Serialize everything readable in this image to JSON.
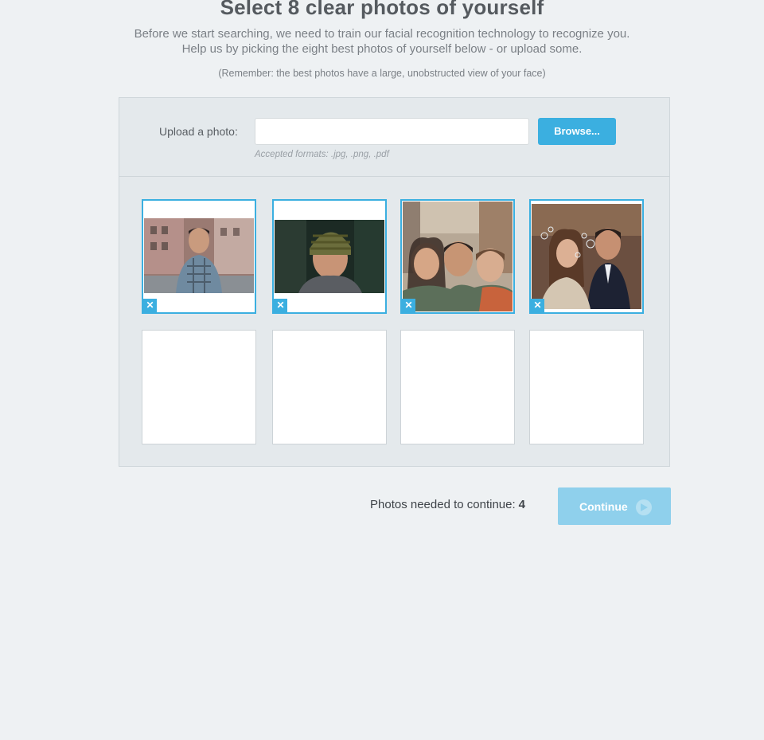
{
  "header": {
    "title": "Select 8 clear photos of yourself",
    "intro_line1": "Before we start searching, we need to train our facial recognition technology to recognize you.",
    "intro_line2": "Help us by picking the eight best photos of yourself below - or upload some.",
    "reminder": "(Remember: the best photos have a large, unobstructed view of your face)"
  },
  "upload": {
    "label": "Upload a photo:",
    "input_value": "",
    "browse_label": "Browse...",
    "formats": "Accepted formats:  .jpg, .png, .pdf"
  },
  "photos": [
    {
      "filled": true,
      "subject": "man in plaid shirt on city street"
    },
    {
      "filled": true,
      "subject": "man in knit beanie"
    },
    {
      "filled": true,
      "subject": "three friends selfie"
    },
    {
      "filled": true,
      "subject": "couple blowing bubbles"
    },
    {
      "filled": false
    },
    {
      "filled": false
    },
    {
      "filled": false
    },
    {
      "filled": false
    }
  ],
  "remove_icon": "close-icon",
  "footer": {
    "needed_label": "Photos needed to continue:",
    "needed_count": "4",
    "continue_label": "Continue",
    "continue_icon": "arrow-right-icon"
  },
  "colors": {
    "accent": "#3bafe0",
    "continue_disabled": "#8fd0ec",
    "background": "#eef1f3"
  }
}
